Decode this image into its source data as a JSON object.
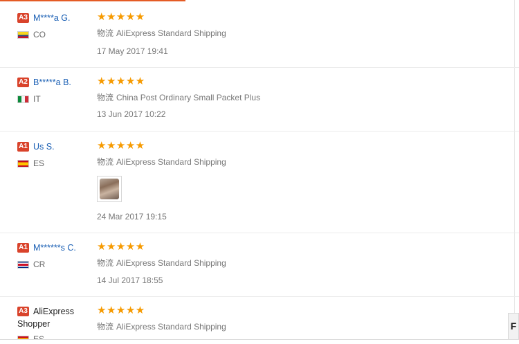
{
  "reviews": [
    {
      "level": "A3",
      "name": "M****a G.",
      "country": "CO",
      "flag": "co",
      "stars": "★★★★★",
      "shipping_label": "物流",
      "shipping": "AliExpress Standard Shipping",
      "date": "17 May 2017 19:41"
    },
    {
      "level": "A2",
      "name": "B*****a B.",
      "country": "IT",
      "flag": "it",
      "stars": "★★★★★",
      "shipping_label": "物流",
      "shipping": "China Post Ordinary Small Packet Plus",
      "date": "13 Jun 2017 10:22"
    },
    {
      "level": "A1",
      "name": "Us S.",
      "country": "ES",
      "flag": "es",
      "stars": "★★★★★",
      "shipping_label": "物流",
      "shipping": "AliExpress Standard Shipping",
      "date": "24 Mar 2017 19:15",
      "has_photo": true
    },
    {
      "level": "A1",
      "name": "M******s C.",
      "country": "CR",
      "flag": "cr",
      "stars": "★★★★★",
      "shipping_label": "物流",
      "shipping": "AliExpress Standard Shipping",
      "date": "14 Jul 2017 18:55"
    },
    {
      "level": "A3",
      "name": "AliExpress Shopper",
      "country": "ES",
      "flag": "es",
      "stars": "★★★★★",
      "shipping_label": "物流",
      "shipping": "AliExpress Standard Shipping"
    }
  ],
  "side_button_label": "F"
}
